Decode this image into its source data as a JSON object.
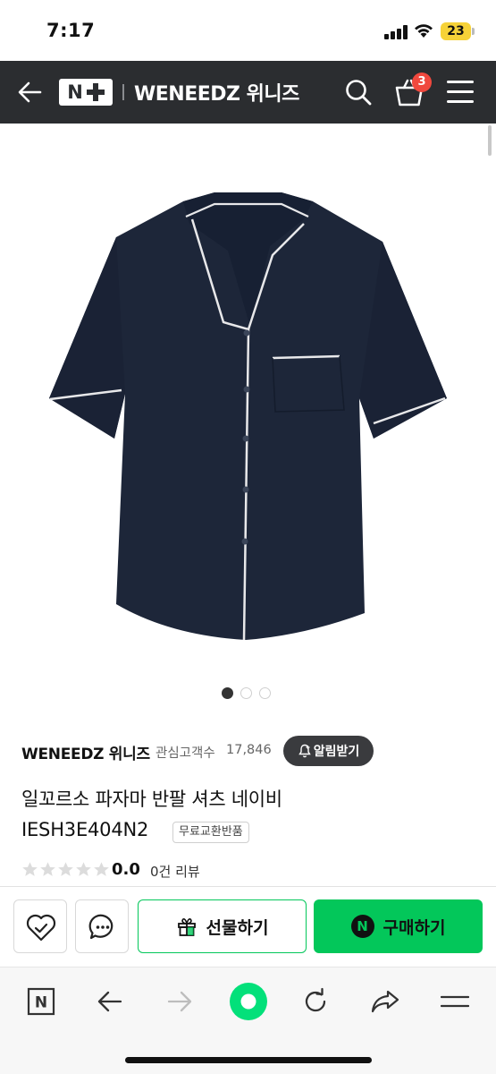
{
  "status_bar": {
    "time": "7:17",
    "battery": "23"
  },
  "header": {
    "logo_text": "N",
    "title": "WENEEDZ 위니즈",
    "cart_count": "3"
  },
  "product": {
    "brand": "WENEEDZ 위니즈",
    "favorites_label": "관심고객수",
    "favorites_count": "17,846",
    "alarm_label": "알림받기",
    "name": "일꼬르소 파자마 반팔 셔츠 네이비",
    "code": "IESH3E404N2",
    "badge": "무료교환반품",
    "rating": "0.0",
    "review_count": "0건 리뷰",
    "image_count": 3,
    "image_index": 1
  },
  "actions": {
    "gift_label": "선물하기",
    "buy_label": "구매하기",
    "naver_letter": "N"
  },
  "browser": {
    "home_letter": "N"
  },
  "colors": {
    "header_bg": "#2b2d30",
    "naver_green": "#03c75a",
    "badge_red": "#f0483e",
    "shirt_navy": "#1d2639"
  },
  "icons": [
    "back-arrow-icon",
    "search-icon",
    "cart-icon",
    "menu-icon",
    "bell-icon",
    "heart-icon",
    "chat-icon",
    "gift-icon",
    "forward-arrow-icon",
    "refresh-icon",
    "share-icon"
  ]
}
